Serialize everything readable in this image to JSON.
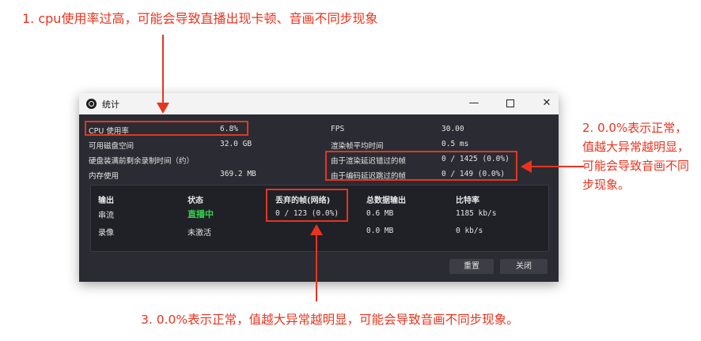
{
  "annotations": {
    "note1": "1. cpu使用率过高，可能会导致直播出现卡顿、音画不同步现象",
    "note2": "2. 0.0%表示正常，值越大异常越明显，可能会导致音画不同步现象。",
    "note3": "3. 0.0%表示正常，值越大异常越明显，可能会导致音画不同步现象。",
    "color": "#e8341f"
  },
  "window": {
    "title": "统计",
    "minimize": "—",
    "close": "✕"
  },
  "stats_left": [
    {
      "label": "CPU 使用率",
      "value": "6.8%"
    },
    {
      "label": "可用磁盘空间",
      "value": "32.0 GB"
    },
    {
      "label": "硬盘装满前剩余录制时间（约）",
      "value": ""
    },
    {
      "label": "内存使用",
      "value": "369.2 MB"
    }
  ],
  "stats_right": [
    {
      "label": "FPS",
      "value": "30.00"
    },
    {
      "label": "渲染帧平均时间",
      "value": "0.5 ms"
    },
    {
      "label": "由于渲染延迟错过的帧",
      "value": "0 / 1425 (0.0%)"
    },
    {
      "label": "由于编码延迟跳过的帧",
      "value": "0 / 149 (0.0%)"
    }
  ],
  "output_table": {
    "headers": [
      "输出",
      "状态",
      "丢弃的帧(网络)",
      "总数据输出",
      "比特率"
    ],
    "rows": [
      [
        "串流",
        "直播中",
        "0 / 123 (0.0%)",
        "0.6 MB",
        "1185 kb/s"
      ],
      [
        "录像",
        "未激活",
        "",
        "0.0 MB",
        "0 kb/s"
      ]
    ],
    "live_color": "#33d14a"
  },
  "buttons": {
    "reset": "重置",
    "close": "关闭"
  }
}
